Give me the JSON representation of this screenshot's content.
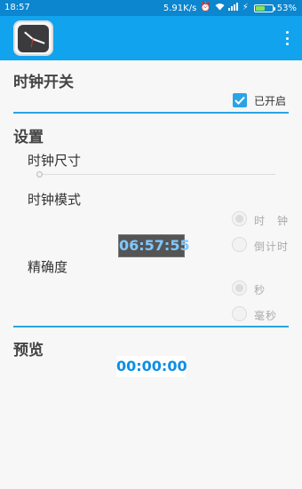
{
  "status_bar": {
    "time": "18:57",
    "network_speed": "5.91K/s",
    "battery": "53%",
    "battery_level": 0.53
  },
  "app_bar": {
    "menu_icon": "more-vert-icon",
    "app_icon": "clock-icon"
  },
  "clock_switch": {
    "title": "时钟开关",
    "checkbox_label": "已开启",
    "checked": true
  },
  "settings": {
    "title": "设置",
    "size_label": "时钟尺寸",
    "size_value": 0.0,
    "mode_label": "时钟模式",
    "mode_options": [
      "时　钟",
      "倒计时"
    ],
    "mode_selected": 0,
    "clock_display": "06:57:55",
    "precision_label": "精确度",
    "precision_options": [
      "秒",
      "毫秒"
    ],
    "precision_selected": 0
  },
  "preview": {
    "title": "预览",
    "display": "00:00:00"
  },
  "colors": {
    "status_bar": "#0b86cf",
    "app_bar": "#11a3ee",
    "accent": "#2aa4e6",
    "preview_text": "#0d8fe3"
  }
}
